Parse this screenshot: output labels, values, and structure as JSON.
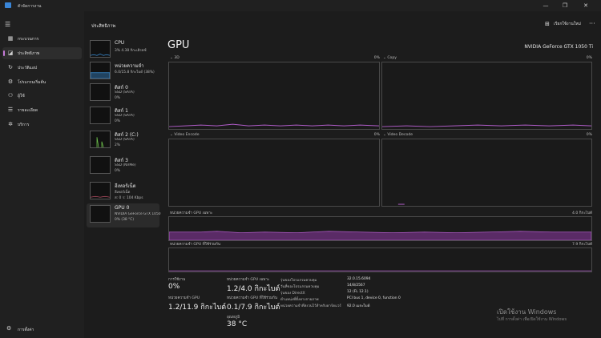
{
  "window": {
    "title": "ตัวจัดการงาน",
    "minimize": "—",
    "maximize": "❐",
    "close": "✕"
  },
  "nav": {
    "menu_icon": "hamburger-icon",
    "items": [
      {
        "label": "กระบวนการ",
        "icon": "processes-icon",
        "glyph": "▦"
      },
      {
        "label": "ประสิทธิภาพ",
        "icon": "performance-icon",
        "glyph": "◪",
        "active": true
      },
      {
        "label": "ประวัติแอป",
        "icon": "history-icon",
        "glyph": "↻"
      },
      {
        "label": "โปรแกรมเริ่มต้น",
        "icon": "startup-icon",
        "glyph": "⚙"
      },
      {
        "label": "ผู้ใช้",
        "icon": "users-icon",
        "glyph": "⚇"
      },
      {
        "label": "รายละเอียด",
        "icon": "details-icon",
        "glyph": "☰"
      },
      {
        "label": "บริการ",
        "icon": "services-icon",
        "glyph": "✲"
      }
    ],
    "settings_label": "การตั้งค่า"
  },
  "header": {
    "section_title": "ประสิทธิภาพ",
    "run_task": "เรียกใช้งานใหม่",
    "more": "···"
  },
  "resources": [
    {
      "name": "CPU",
      "sub": "3%  4.38 กิกะเฮิรตซ์",
      "val": "",
      "color": "#3a8fd8"
    },
    {
      "name": "หน่วยความจำ",
      "sub": "6.0/15.8 กิกะไบต์ (38%)",
      "val": "",
      "color": "#3a8fd8"
    },
    {
      "name": "ดิสก์ 0",
      "sub": "SSD (SATA)",
      "val": "0%",
      "color": "#6cbf4a"
    },
    {
      "name": "ดิสก์ 1",
      "sub": "SSD (SATA)",
      "val": "0%",
      "color": "#6cbf4a"
    },
    {
      "name": "ดิสก์ 2 (C:)",
      "sub": "SSD (SATA)",
      "val": "2%",
      "color": "#6cbf4a"
    },
    {
      "name": "ดิสก์ 3",
      "sub": "SSD (NVMe)",
      "val": "0%",
      "color": "#6cbf4a"
    },
    {
      "name": "อีเทอร์เน็ต",
      "sub": "อีเทอร์เน็ต",
      "val": "ส: 0  ร: 104 Kbps",
      "color": "#c0546a"
    },
    {
      "name": "GPU 0",
      "sub": "NVIDIA GeForce GTX 1050 Ti",
      "val": "0% (38 °C)",
      "color": "#b05cc8",
      "active": true
    }
  ],
  "gpu": {
    "title": "GPU",
    "model": "NVIDIA GeForce GTX 1050 Ti",
    "engines": [
      {
        "label": "3D",
        "pct": "0%"
      },
      {
        "label": "Copy",
        "pct": "0%"
      },
      {
        "label": "Video Encode",
        "pct": "0%"
      },
      {
        "label": "Video Decode",
        "pct": "0%"
      }
    ],
    "dedicated_label": "หน่วยความจำ GPU เฉพาะ",
    "dedicated_max": "4.0 กิกะไบต์",
    "shared_label": "หน่วยความจำ GPU ที่ใช้ร่วมกัน",
    "shared_max": "7.9 กิกะไบต์",
    "accent": "#b05cc8"
  },
  "stats": {
    "utilization_label": "การใช้งาน",
    "utilization": "0%",
    "dedicated_label": "หน่วยความจำ GPU เฉพาะ",
    "dedicated": "1.2/4.0 กิกะไบต์",
    "gpu_mem_label": "หน่วยความจำ GPU",
    "gpu_mem": "1.2/11.9 กิกะไบต์",
    "shared_label": "หน่วยความจำ GPU ที่ใช้ร่วมกัน",
    "shared": "0.1/7.9 กิกะไบต์",
    "temp_label": "อุณหภูมิ",
    "temp": "38 °C"
  },
  "info": [
    {
      "k": "รุ่นของโปรแกรมควบคุม",
      "v": "32.0.15.6094"
    },
    {
      "k": "วันที่ของโปรแกรมควบคุม",
      "v": "14/8/2567"
    },
    {
      "k": "รุ่นของ DirectX",
      "v": "12 (FL 12.1)"
    },
    {
      "k": "ตำแหน่งที่ตั้งทางกายภาพ",
      "v": "PCI bus 1, device 0, function 0"
    },
    {
      "k": "หน่วยความจำที่สงวนไว้สำหรับฮาร์ดแวร์",
      "v": "92.0 เมกะไบต์"
    }
  ],
  "watermark": {
    "line1": "เปิดใช้งาน Windows",
    "line2": "ไปที่ การตั้งค่า เพื่อเปิดใช้งาน Windows"
  }
}
